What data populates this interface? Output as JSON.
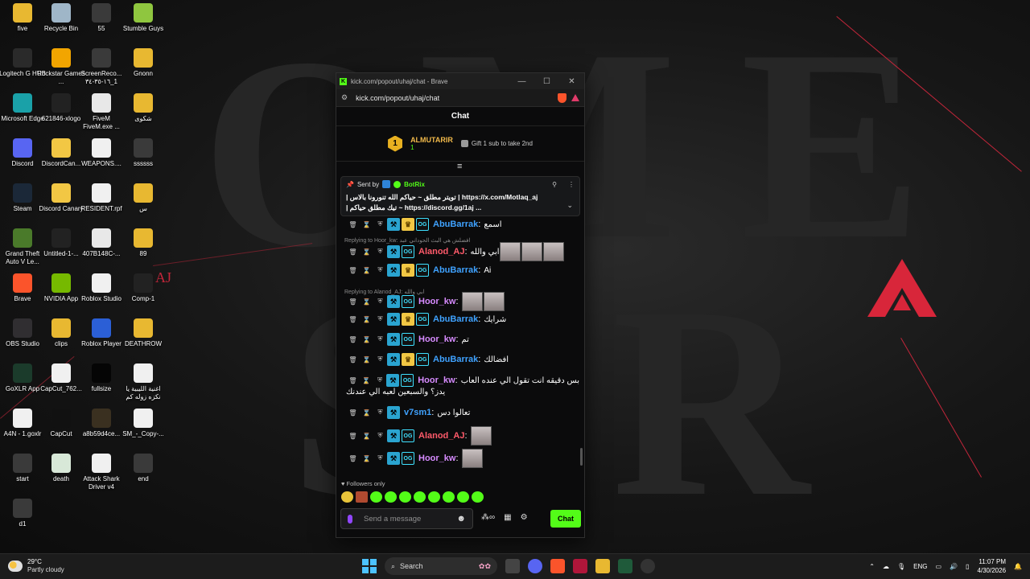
{
  "desktop": {
    "icons": [
      {
        "label": "five",
        "color": "#e8b831"
      },
      {
        "label": "Recycle Bin",
        "color": "#9fb6c8"
      },
      {
        "label": "55",
        "color": "#3a3a3a"
      },
      {
        "label": "Stumble Guys",
        "color": "#8fc63f"
      },
      {
        "label": "Logitech G HUB",
        "color": "#2a2a2a"
      },
      {
        "label": "Rockstar Games ...",
        "color": "#f2a500"
      },
      {
        "label": "ScreenReco... ١٦-٣٥-٣٤_1",
        "color": "#3a3a3a"
      },
      {
        "label": "Gnonn",
        "color": "#e8b831"
      },
      {
        "label": "Microsoft Edge",
        "color": "#1aa1a8"
      },
      {
        "label": "621846-xlogo",
        "color": "#222"
      },
      {
        "label": "FiveM FiveM.exe ...",
        "color": "#e8e8e8"
      },
      {
        "label": "شكوى",
        "color": "#e8b831"
      },
      {
        "label": "Discord",
        "color": "#5865f2"
      },
      {
        "label": "DiscordCan...",
        "color": "#f2c744"
      },
      {
        "label": "WEAPONS....",
        "color": "#f0f0f0"
      },
      {
        "label": "ssssss",
        "color": "#3a3a3a"
      },
      {
        "label": "Steam",
        "color": "#1b2838"
      },
      {
        "label": "Discord Canary",
        "color": "#f2c744"
      },
      {
        "label": "RESIDENT.rpf",
        "color": "#f0f0f0"
      },
      {
        "label": "س",
        "color": "#e8b831"
      },
      {
        "label": "Grand Theft Auto V Le...",
        "color": "#4a7a2a"
      },
      {
        "label": "Untitled-1-...",
        "color": "#222"
      },
      {
        "label": "407B148C-...",
        "color": "#e8e8e8"
      },
      {
        "label": "89",
        "color": "#e8b831"
      },
      {
        "label": "Brave",
        "color": "#fb542b"
      },
      {
        "label": "NVIDIA App",
        "color": "#76b900"
      },
      {
        "label": "Roblox Studio",
        "color": "#f0f0f0"
      },
      {
        "label": "Comp-1",
        "color": "#222"
      },
      {
        "label": "OBS Studio",
        "color": "#302e31"
      },
      {
        "label": "clips",
        "color": "#e8b831"
      },
      {
        "label": "Roblox Player",
        "color": "#2b5fd6"
      },
      {
        "label": "DEATHROW",
        "color": "#e8b831"
      },
      {
        "label": "GoXLR App",
        "color": "#1b3b2b"
      },
      {
        "label": "CapCut_762...",
        "color": "#f0f0f0"
      },
      {
        "label": "fullsize",
        "color": "#050505"
      },
      {
        "label": "اغنية الليبية يا نكزه زوله كم",
        "color": "#f0f0f0"
      },
      {
        "label": "A4N - 1.goxlr",
        "color": "#f0f0f0"
      },
      {
        "label": "CapCut",
        "color": "#111"
      },
      {
        "label": "a8b59d4ce...",
        "color": "#3a3020"
      },
      {
        "label": "SM_-_Copy-...",
        "color": "#f0f0f0"
      },
      {
        "label": "start",
        "color": "#3a3a3a"
      },
      {
        "label": "death",
        "color": "#d8e8d8"
      },
      {
        "label": "Attack Shark Driver v4",
        "color": "#f0f0f0"
      },
      {
        "label": "end",
        "color": "#3a3a3a"
      },
      {
        "label": "d1",
        "color": "#3a3a3a"
      }
    ],
    "wallpaper_text": "AJ"
  },
  "browser": {
    "title": "kick.com/popout/uhaj/chat - Brave",
    "address": "kick.com/popout/uhaj/chat",
    "minimize": "—",
    "maximize": "☐",
    "close": "✕"
  },
  "chat": {
    "header": "Chat",
    "leaderboard": {
      "rank": "1",
      "name": "ALMUTARIR",
      "count": "1",
      "gift_text": "Gift 1 sub to take 2nd"
    },
    "pinned": {
      "sent_by": "Sent by",
      "bot_name": "BotRix",
      "line1": "| تويتر مطلق ~ حياكم الله تنورونا بالاس | https://x.com/Motlaq_aj",
      "line2": "| تيك مطلق حياكم ~ https://discord.gg/1aj ..."
    },
    "messages": [
      {
        "user": "AbuBarrak",
        "color": "#3fa2ff",
        "text": "اسمع",
        "crown": true
      },
      {
        "reply": "Replying to Hoor_kw: افضلش هي البث الحوداني عبد"
      },
      {
        "user": "Alanod_AJ",
        "color": "#ff5a6a",
        "text": "ابي والله",
        "crown": false,
        "emotes": 3
      },
      {
        "user": "AbuBarrak",
        "color": "#3fa2ff",
        "text": "Ai",
        "crown": true
      },
      {
        "reply": "Replying to Alanod_AJ: ابي والله"
      },
      {
        "user": "Hoor_kw",
        "color": "#d78bff",
        "text": "",
        "crown": false,
        "emotes": 2
      },
      {
        "user": "AbuBarrak",
        "color": "#3fa2ff",
        "text": "شرايك",
        "crown": true
      },
      {
        "user": "Hoor_kw",
        "color": "#d78bff",
        "text": "تم",
        "crown": false
      },
      {
        "user": "AbuBarrak",
        "color": "#3fa2ff",
        "text": "افضالك",
        "crown": true
      },
      {
        "user": "Hoor_kw",
        "color": "#d78bff",
        "text": "بس دقيقه انت تقول الي عنده العاب",
        "text2": "يدز؟ والسبعين لعبه الي عندنك",
        "crown": false
      },
      {
        "user": "v7sm1",
        "color": "#3fa2ff",
        "text": "تعالوا دس",
        "crown": false,
        "no_og": true
      },
      {
        "user": "Alanod_AJ",
        "color": "#ff5a6a",
        "text": "",
        "crown": false,
        "emotes": 1
      },
      {
        "user": "Hoor_kw",
        "color": "#d78bff",
        "text": "",
        "crown": false,
        "emotes": 1
      }
    ],
    "followers_only": "Followers only",
    "input_placeholder": "Send a message",
    "send_label": "Chat"
  },
  "taskbar": {
    "temp": "29°C",
    "weather": "Partly cloudy",
    "search_placeholder": "Search",
    "lang": "ENG",
    "time": "11:07 PM",
    "date": "4/30/2026"
  }
}
